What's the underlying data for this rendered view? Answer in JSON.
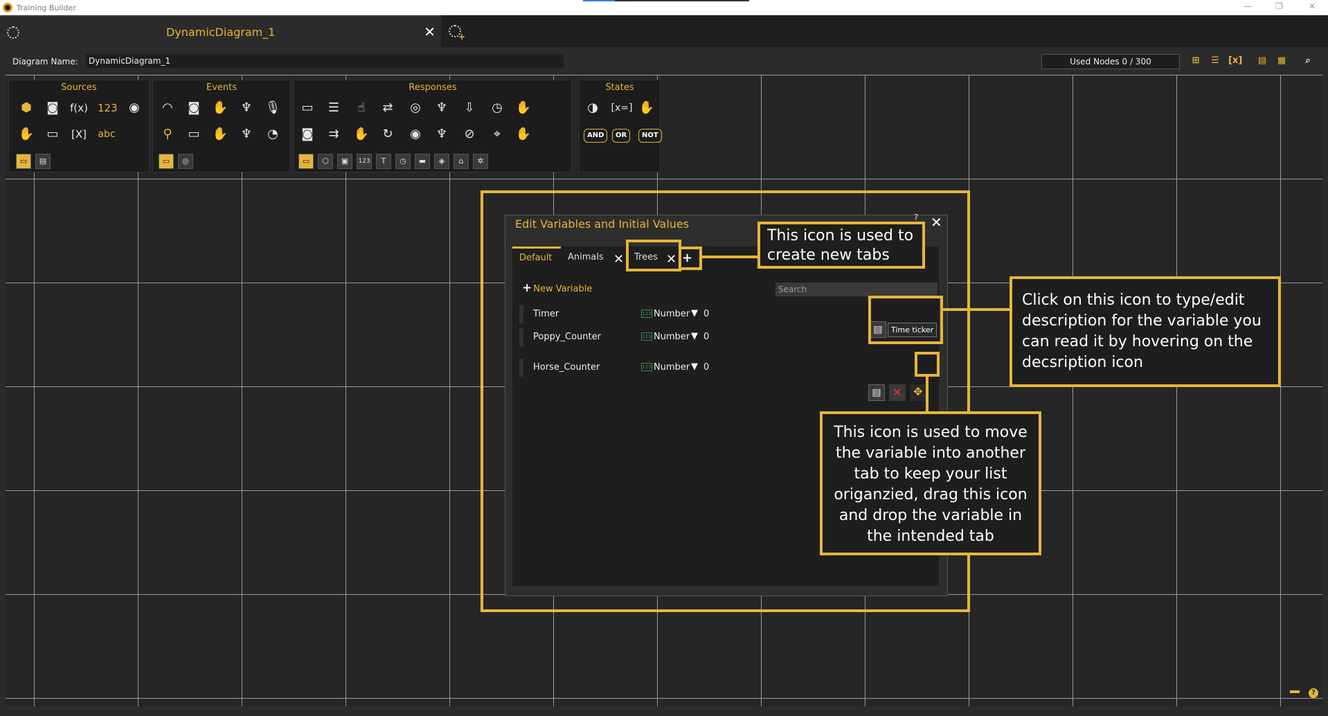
{
  "window": {
    "app_title": "Training Builder",
    "restore_glyph": "❐"
  },
  "document_tab": {
    "title": "DynamicDiagram_1",
    "close": "✕"
  },
  "topbar": {
    "diagram_name_label": "Diagram Name:",
    "diagram_name_value": "DynamicDiagram_1",
    "used_nodes": "Used Nodes 0 / 300",
    "tool_icons": [
      "add-node-icon",
      "group-icon",
      "variables-icon",
      "notes-icon",
      "grid-icon",
      "search-icon"
    ]
  },
  "palette": {
    "sources": {
      "title": "Sources",
      "fx": "f(x)",
      "num": "123",
      "var": "[X]",
      "text": "abc"
    },
    "events": {
      "title": "Events"
    },
    "responses": {
      "title": "Responses",
      "num": "123",
      "text": "T"
    },
    "states": {
      "title": "States",
      "assign": "[x=]",
      "and": "AND",
      "or": "OR",
      "not": "NOT"
    }
  },
  "dialog": {
    "title": "Edit Variables and Initial Values",
    "help": "?",
    "close": "✕",
    "tabs": [
      {
        "label": "Default"
      },
      {
        "label": "Animals"
      },
      {
        "label": "Trees"
      }
    ],
    "new_variable": "New Variable",
    "search_placeholder": "Search",
    "variables": [
      {
        "name": "Timer",
        "type": "Number",
        "value": "0"
      },
      {
        "name": "Poppy_Counter",
        "type": "Number",
        "value": "0"
      },
      {
        "name": "Horse_Counter",
        "type": "Number",
        "value": "0"
      }
    ],
    "tooltip": "Time ticker",
    "number_icon_text": "123"
  },
  "callouts": {
    "new_tabs": "This icon is used to create new tabs",
    "description": "Click on this icon to type/edit description for the variable you can read it by hovering on the decsription icon",
    "move": "This icon is used to move the variable into another tab to keep your list origanzied, drag this icon and drop the variable in the intended tab"
  },
  "colors": {
    "accent": "#e6b63a",
    "background": "#262626",
    "grid": "#9a9a9a"
  }
}
